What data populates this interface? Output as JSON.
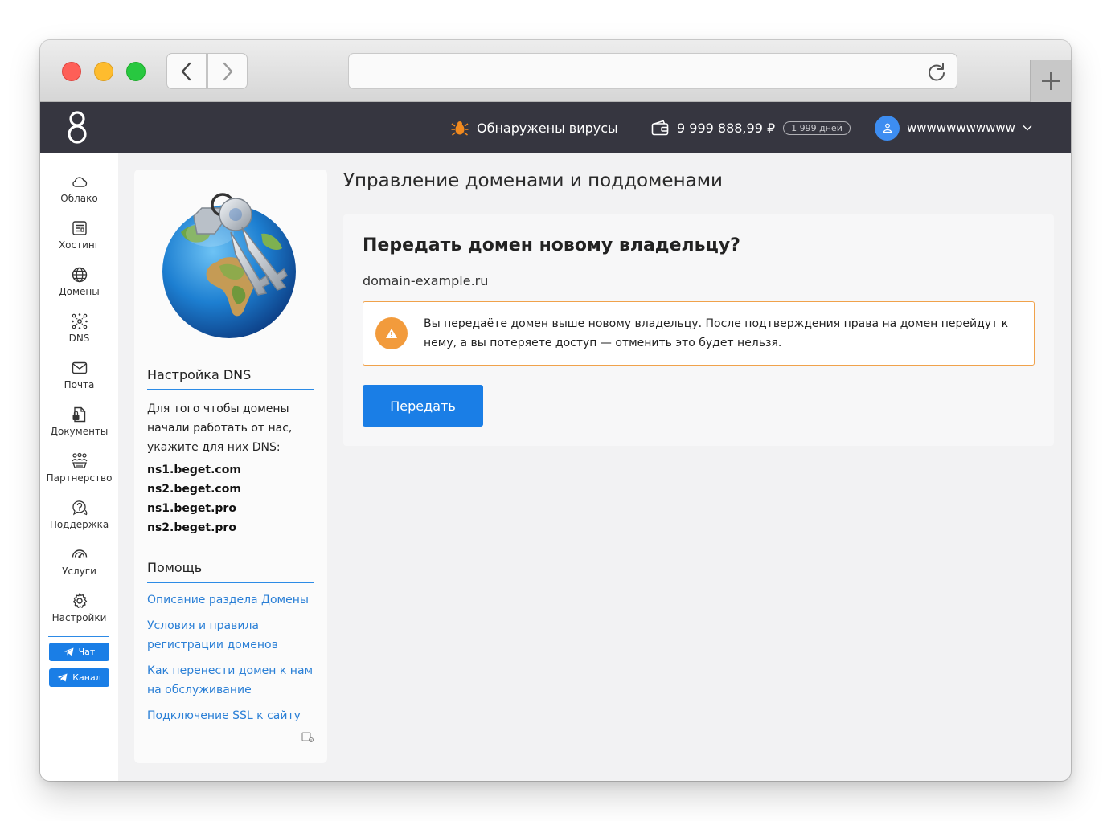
{
  "header": {
    "virus_text": "Обнаружены вирусы",
    "balance": "9 999 888,99 ₽",
    "days": "1 999 дней",
    "username": "wwwwwwwwwww"
  },
  "sidebar": {
    "items": [
      {
        "label": "Облако",
        "icon": "cloud-icon"
      },
      {
        "label": "Хостинг",
        "icon": "hosting-icon"
      },
      {
        "label": "Домены",
        "icon": "globe-icon"
      },
      {
        "label": "DNS",
        "icon": "dns-icon"
      },
      {
        "label": "Почта",
        "icon": "mail-icon"
      },
      {
        "label": "Документы",
        "icon": "documents-icon"
      },
      {
        "label": "Партнерство",
        "icon": "partners-icon"
      },
      {
        "label": "Поддержка",
        "icon": "support-icon"
      },
      {
        "label": "Услуги",
        "icon": "services-icon"
      },
      {
        "label": "Настройки",
        "icon": "gear-icon"
      }
    ],
    "chat_label": "Чат",
    "channel_label": "Канал"
  },
  "info": {
    "dns_title": "Настройка DNS",
    "dns_text": "Для того чтобы домены начали работать от нас, укажите для них DNS:",
    "nameservers": [
      "ns1.beget.com",
      "ns2.beget.com",
      "ns1.beget.pro",
      "ns2.beget.pro"
    ],
    "help_title": "Помощь",
    "help_links": [
      "Описание раздела Домены",
      "Условия и правила регистрации доменов",
      "Как перенести домен к нам на обслуживание",
      "Подключение SSL к сайту"
    ]
  },
  "main": {
    "page_title": "Управление доменами и поддоменами",
    "card_title": "Передать домен новому владельцу?",
    "domain": "domain-example.ru",
    "warning": "Вы передаёте домен выше новому владельцу. После подтверждения права на домен перейдут к нему, а вы потеряете доступ — отменить это будет нельзя.",
    "transfer_label": "Передать"
  },
  "colors": {
    "accent": "#1a7ee6",
    "header_bg": "#363640",
    "warning_border": "#f0a24b",
    "warning_icon": "#f29b3c"
  }
}
